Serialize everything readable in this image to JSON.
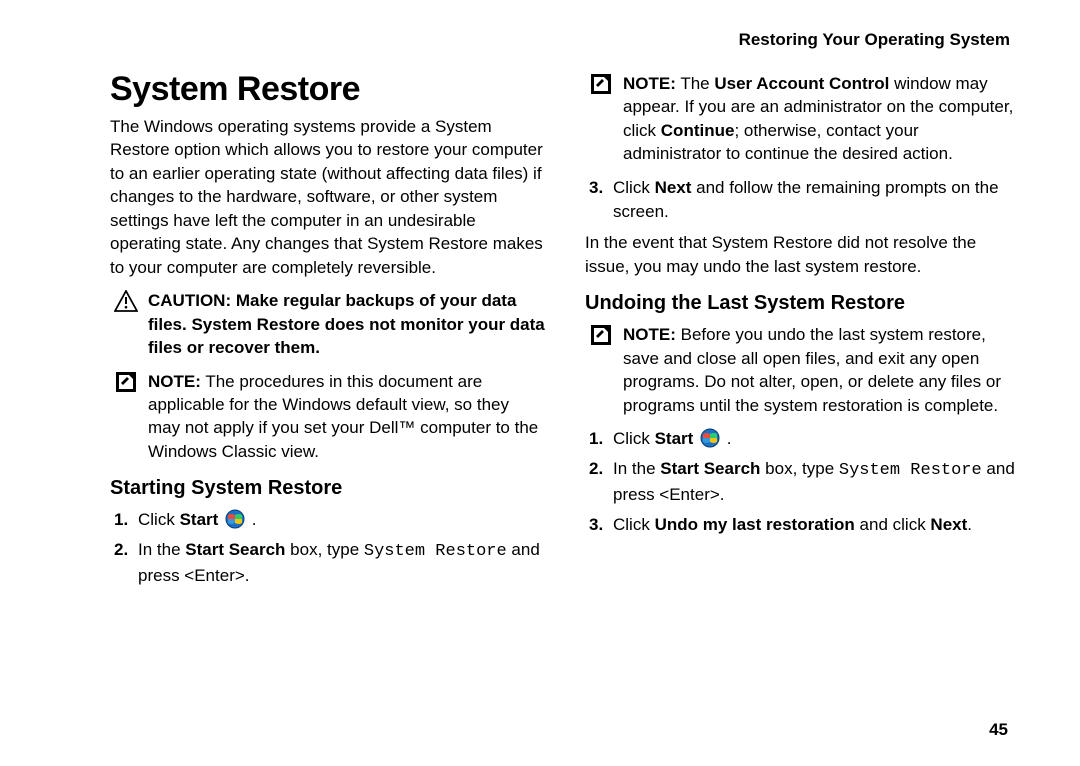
{
  "header": {
    "running": "Restoring Your Operating System"
  },
  "title": "System Restore",
  "intro": "The Windows operating systems provide a System Restore option which allows you to restore your computer to an earlier operating state (without affecting data files) if changes to the hardware, software, or other system settings have left the computer in an undesirable operating state. Any changes that System Restore makes to your computer are completely reversible.",
  "caution": {
    "label": "CAUTION:",
    "text": "Make regular backups of your data files. System Restore does not monitor your data files or recover them."
  },
  "note1": {
    "label": "NOTE:",
    "text": "The procedures in this document are applicable for the Windows default view, so they may not apply if you set your Dell™ computer to the Windows Classic view."
  },
  "section1": {
    "heading": "Starting System Restore",
    "step1_pre": "Click ",
    "step1_bold": "Start",
    "step1_post": " .",
    "step2_pre": "In the ",
    "step2_bold1": "Start Search",
    "step2_mid": " box, type ",
    "step2_mono": "System Restore",
    "step2_post": " and press <Enter>."
  },
  "note2": {
    "label": "NOTE:",
    "text_pre": "The ",
    "text_bold1": "User Account Control",
    "text_mid": " window may appear. If you are an administrator on the computer, click ",
    "text_bold2": "Continue",
    "text_post": "; otherwise, contact your administrator to continue the desired action."
  },
  "step3": {
    "pre": "Click ",
    "bold": "Next",
    "post": " and follow the remaining prompts on the screen."
  },
  "para_after": "In the event that System Restore did not resolve the issue, you may undo the last system restore.",
  "section2": {
    "heading": "Undoing the Last System Restore",
    "note": {
      "label": "NOTE:",
      "text": "Before you undo the last system restore, save and close all open files, and exit any open programs. Do not alter, open, or delete any files or programs until the system restoration is complete."
    },
    "step1_pre": "Click ",
    "step1_bold": "Start",
    "step1_post": " .",
    "step2_pre": "In the ",
    "step2_bold1": "Start Search",
    "step2_mid": " box, type ",
    "step2_mono": "System Restore",
    "step2_post": " and press <Enter>.",
    "step3_pre": "Click ",
    "step3_bold1": "Undo my last restoration",
    "step3_mid": " and click ",
    "step3_bold2": "Next",
    "step3_post": "."
  },
  "page_number": "45"
}
